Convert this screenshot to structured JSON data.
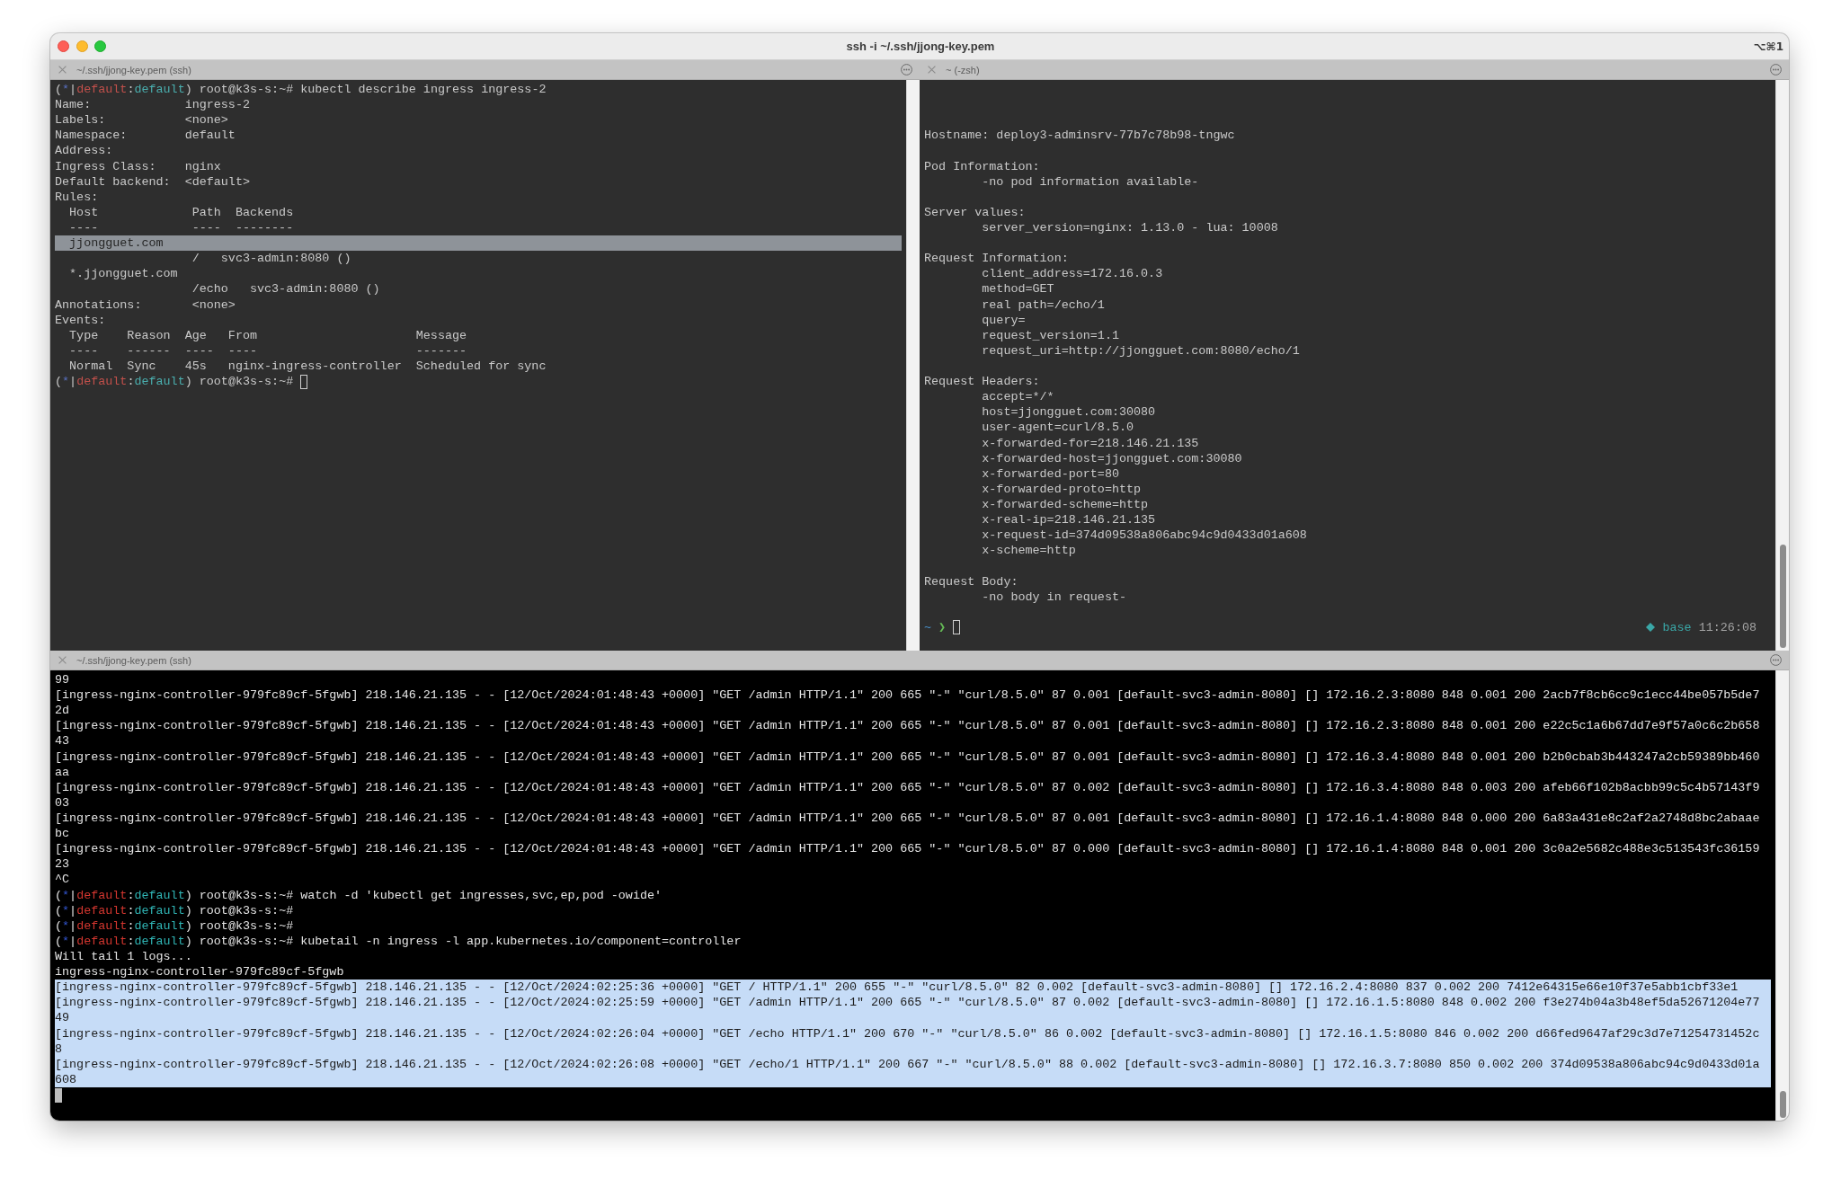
{
  "window": {
    "title": "ssh -i ~/.ssh/jjong-key.pem",
    "shortcut": "⌥⌘1"
  },
  "pane_rows": [
    {
      "panes": [
        {
          "title": "~/.ssh/jjong-key.pem (ssh)",
          "active": false,
          "blocks": [
            {
              "lines": [
                {
                  "kind": "prompt",
                  "segments": [
                    {
                      "kind": "plain",
                      "text": "("
                    },
                    {
                      "kind": "marker",
                      "text": "*"
                    },
                    {
                      "kind": "plain",
                      "text": "|"
                    },
                    {
                      "kind": "context",
                      "text": "default"
                    },
                    {
                      "kind": "plain",
                      "text": ":"
                    },
                    {
                      "kind": "namespace",
                      "text": "default"
                    },
                    {
                      "kind": "plain",
                      "text": ") root@k3s-s:~# kubectl describe ingress ingress-2"
                    }
                  ],
                  "cursor": false,
                  "selected": false
                },
                {
                  "kind": "output",
                  "text": "Name:             ingress-2",
                  "selected": false
                },
                {
                  "kind": "output",
                  "text": "Labels:           <none>",
                  "selected": false
                },
                {
                  "kind": "output",
                  "text": "Namespace:        default",
                  "selected": false
                },
                {
                  "kind": "output",
                  "text": "Address:",
                  "selected": false
                },
                {
                  "kind": "output",
                  "text": "Ingress Class:    nginx",
                  "selected": false
                },
                {
                  "kind": "output",
                  "text": "Default backend:  <default>",
                  "selected": false
                },
                {
                  "kind": "output",
                  "text": "Rules:",
                  "selected": false
                },
                {
                  "kind": "output",
                  "text": "  Host             Path  Backends",
                  "selected": false
                },
                {
                  "kind": "output",
                  "text": "  ----             ----  --------",
                  "selected": false
                },
                {
                  "kind": "output",
                  "text": "  jjongguet.com",
                  "selected": true
                },
                {
                  "kind": "output",
                  "text": "                   /   svc3-admin:8080 ()",
                  "selected": false
                },
                {
                  "kind": "output",
                  "text": "  *.jjongguet.com",
                  "selected": false
                },
                {
                  "kind": "output",
                  "text": "                   /echo   svc3-admin:8080 ()",
                  "selected": false
                },
                {
                  "kind": "output",
                  "text": "Annotations:       <none>",
                  "selected": false
                },
                {
                  "kind": "output",
                  "text": "Events:",
                  "selected": false
                },
                {
                  "kind": "output",
                  "text": "  Type    Reason  Age   From                      Message",
                  "selected": false
                },
                {
                  "kind": "output",
                  "text": "  ----    ------  ----  ----                      -------",
                  "selected": false
                },
                {
                  "kind": "output",
                  "text": "  Normal  Sync    45s   nginx-ingress-controller  Scheduled for sync",
                  "selected": false
                },
                {
                  "kind": "prompt",
                  "segments": [
                    {
                      "kind": "plain",
                      "text": "("
                    },
                    {
                      "kind": "marker",
                      "text": "*"
                    },
                    {
                      "kind": "plain",
                      "text": "|"
                    },
                    {
                      "kind": "context",
                      "text": "default"
                    },
                    {
                      "kind": "plain",
                      "text": ":"
                    },
                    {
                      "kind": "namespace",
                      "text": "default"
                    },
                    {
                      "kind": "plain",
                      "text": ") root@k3s-s:~#"
                    }
                  ],
                  "cursor": true,
                  "selected": false
                }
              ]
            }
          ]
        },
        {
          "title": "~ (-zsh)",
          "active": false,
          "blocks": [
            {
              "lines": [
                {
                  "kind": "output",
                  "text": "Hostname: deploy3-adminsrv-77b7c78b98-tngwc",
                  "selected": false
                }
              ]
            },
            {
              "lines": [
                {
                  "kind": "output",
                  "text": "Pod Information:",
                  "selected": false
                },
                {
                  "kind": "output",
                  "text": "        -no pod information available-",
                  "selected": false
                }
              ]
            },
            {
              "lines": [
                {
                  "kind": "output",
                  "text": "Server values:",
                  "selected": false
                },
                {
                  "kind": "output",
                  "text": "        server_version=nginx: 1.13.0 - lua: 10008",
                  "selected": false
                }
              ]
            },
            {
              "lines": [
                {
                  "kind": "output",
                  "text": "Request Information:",
                  "selected": false
                },
                {
                  "kind": "output",
                  "text": "        client_address=172.16.0.3",
                  "selected": false
                },
                {
                  "kind": "output",
                  "text": "        method=GET",
                  "selected": false
                },
                {
                  "kind": "output",
                  "text": "        real path=/echo/1",
                  "selected": false
                },
                {
                  "kind": "output",
                  "text": "        query=",
                  "selected": false
                },
                {
                  "kind": "output",
                  "text": "        request_version=1.1",
                  "selected": false
                },
                {
                  "kind": "output",
                  "text": "        request_uri=http://jjongguet.com:8080/echo/1",
                  "selected": false
                }
              ]
            },
            {
              "lines": [
                {
                  "kind": "output",
                  "text": "Request Headers:",
                  "selected": false
                },
                {
                  "kind": "output",
                  "text": "        accept=*/*",
                  "selected": false
                },
                {
                  "kind": "output",
                  "text": "        host=jjongguet.com:30080",
                  "selected": false
                },
                {
                  "kind": "output",
                  "text": "        user-agent=curl/8.5.0",
                  "selected": false
                },
                {
                  "kind": "output",
                  "text": "        x-forwarded-for=218.146.21.135",
                  "selected": false
                },
                {
                  "kind": "output",
                  "text": "        x-forwarded-host=jjongguet.com:30080",
                  "selected": false
                },
                {
                  "kind": "output",
                  "text": "        x-forwarded-port=80",
                  "selected": false
                },
                {
                  "kind": "output",
                  "text": "        x-forwarded-proto=http",
                  "selected": false
                },
                {
                  "kind": "output",
                  "text": "        x-forwarded-scheme=http",
                  "selected": false
                },
                {
                  "kind": "output",
                  "text": "        x-real-ip=218.146.21.135",
                  "selected": false
                },
                {
                  "kind": "output",
                  "text": "        x-request-id=374d09538a806abc94c9d0433d01a608",
                  "selected": false
                },
                {
                  "kind": "output",
                  "text": "        x-scheme=http",
                  "selected": false
                }
              ]
            },
            {
              "lines": [
                {
                  "kind": "output",
                  "text": "Request Body:",
                  "selected": false
                },
                {
                  "kind": "output",
                  "text": "        -no body in request-",
                  "selected": false
                }
              ]
            },
            {
              "lines": [
                {
                  "kind": "prompt",
                  "segments": [
                    {
                      "kind": "path",
                      "text": "~"
                    },
                    {
                      "kind": "arrow",
                      "text": " ❯"
                    }
                  ],
                  "cursor": true,
                  "selected": false,
                  "status": [
                    {
                      "kind": "env",
                      "text": "base"
                    },
                    {
                      "kind": "time",
                      "text": "11:26:08"
                    }
                  ]
                }
              ]
            }
          ]
        }
      ]
    },
    {
      "panes": [
        {
          "title": "~/.ssh/jjong-key.pem (ssh)",
          "active": true,
          "blocks": [
            {
              "lines": [
                {
                  "kind": "output",
                  "text": "99",
                  "selected": false
                },
                {
                  "kind": "output",
                  "text": "[ingress-nginx-controller-979fc89cf-5fgwb] 218.146.21.135 - - [12/Oct/2024:01:48:43 +0000] \"GET /admin HTTP/1.1\" 200 665 \"-\" \"curl/8.5.0\" 87 0.001 [default-svc3-admin-8080] [] 172.16.2.3:8080 848 0.001 200 2acb7f8cb6cc9c1ecc44be057b5de7",
                  "selected": false
                },
                {
                  "kind": "output",
                  "text": "2d",
                  "selected": false
                },
                {
                  "kind": "output",
                  "text": "[ingress-nginx-controller-979fc89cf-5fgwb] 218.146.21.135 - - [12/Oct/2024:01:48:43 +0000] \"GET /admin HTTP/1.1\" 200 665 \"-\" \"curl/8.5.0\" 87 0.001 [default-svc3-admin-8080] [] 172.16.2.3:8080 848 0.001 200 e22c5c1a6b67dd7e9f57a0c6c2b658",
                  "selected": false
                },
                {
                  "kind": "output",
                  "text": "43",
                  "selected": false
                },
                {
                  "kind": "output",
                  "text": "[ingress-nginx-controller-979fc89cf-5fgwb] 218.146.21.135 - - [12/Oct/2024:01:48:43 +0000] \"GET /admin HTTP/1.1\" 200 665 \"-\" \"curl/8.5.0\" 87 0.001 [default-svc3-admin-8080] [] 172.16.3.4:8080 848 0.001 200 b2b0cbab3b443247a2cb59389bb460",
                  "selected": false
                },
                {
                  "kind": "output",
                  "text": "aa",
                  "selected": false
                },
                {
                  "kind": "output",
                  "text": "[ingress-nginx-controller-979fc89cf-5fgwb] 218.146.21.135 - - [12/Oct/2024:01:48:43 +0000] \"GET /admin HTTP/1.1\" 200 665 \"-\" \"curl/8.5.0\" 87 0.002 [default-svc3-admin-8080] [] 172.16.3.4:8080 848 0.003 200 afeb66f102b8acbb99c5c4b57143f9",
                  "selected": false
                },
                {
                  "kind": "output",
                  "text": "03",
                  "selected": false
                },
                {
                  "kind": "output",
                  "text": "[ingress-nginx-controller-979fc89cf-5fgwb] 218.146.21.135 - - [12/Oct/2024:01:48:43 +0000] \"GET /admin HTTP/1.1\" 200 665 \"-\" \"curl/8.5.0\" 87 0.001 [default-svc3-admin-8080] [] 172.16.1.4:8080 848 0.000 200 6a83a431e8c2af2a2748d8bc2abaae",
                  "selected": false
                },
                {
                  "kind": "output",
                  "text": "bc",
                  "selected": false
                },
                {
                  "kind": "output",
                  "text": "[ingress-nginx-controller-979fc89cf-5fgwb] 218.146.21.135 - - [12/Oct/2024:01:48:43 +0000] \"GET /admin HTTP/1.1\" 200 665 \"-\" \"curl/8.5.0\" 87 0.000 [default-svc3-admin-8080] [] 172.16.1.4:8080 848 0.001 200 3c0a2e5682c488e3c513543fc36159",
                  "selected": false
                },
                {
                  "kind": "output",
                  "text": "23",
                  "selected": false
                },
                {
                  "kind": "output",
                  "text": "^C",
                  "selected": false
                },
                {
                  "kind": "prompt",
                  "segments": [
                    {
                      "kind": "plain",
                      "text": "("
                    },
                    {
                      "kind": "marker",
                      "text": "*"
                    },
                    {
                      "kind": "plain",
                      "text": "|"
                    },
                    {
                      "kind": "context",
                      "text": "default"
                    },
                    {
                      "kind": "plain",
                      "text": ":"
                    },
                    {
                      "kind": "namespace",
                      "text": "default"
                    },
                    {
                      "kind": "plain",
                      "text": ") root@k3s-s:~# watch -d 'kubectl get ingresses,svc,ep,pod -owide'"
                    }
                  ],
                  "cursor": false,
                  "selected": false
                },
                {
                  "kind": "prompt",
                  "segments": [
                    {
                      "kind": "plain",
                      "text": "("
                    },
                    {
                      "kind": "marker",
                      "text": "*"
                    },
                    {
                      "kind": "plain",
                      "text": "|"
                    },
                    {
                      "kind": "context",
                      "text": "default"
                    },
                    {
                      "kind": "plain",
                      "text": ":"
                    },
                    {
                      "kind": "namespace",
                      "text": "default"
                    },
                    {
                      "kind": "plain",
                      "text": ") root@k3s-s:~#"
                    }
                  ],
                  "cursor": false,
                  "selected": false
                },
                {
                  "kind": "prompt",
                  "segments": [
                    {
                      "kind": "plain",
                      "text": "("
                    },
                    {
                      "kind": "marker",
                      "text": "*"
                    },
                    {
                      "kind": "plain",
                      "text": "|"
                    },
                    {
                      "kind": "context",
                      "text": "default"
                    },
                    {
                      "kind": "plain",
                      "text": ":"
                    },
                    {
                      "kind": "namespace",
                      "text": "default"
                    },
                    {
                      "kind": "plain",
                      "text": ") root@k3s-s:~#"
                    }
                  ],
                  "cursor": false,
                  "selected": false
                },
                {
                  "kind": "prompt",
                  "segments": [
                    {
                      "kind": "plain",
                      "text": "("
                    },
                    {
                      "kind": "marker",
                      "text": "*"
                    },
                    {
                      "kind": "plain",
                      "text": "|"
                    },
                    {
                      "kind": "context",
                      "text": "default"
                    },
                    {
                      "kind": "plain",
                      "text": ":"
                    },
                    {
                      "kind": "namespace",
                      "text": "default"
                    },
                    {
                      "kind": "plain",
                      "text": ") root@k3s-s:~# kubetail -n ingress -l app.kubernetes.io/component=controller"
                    }
                  ],
                  "cursor": false,
                  "selected": false
                },
                {
                  "kind": "output",
                  "text": "Will tail 1 logs...",
                  "selected": false
                },
                {
                  "kind": "output",
                  "text": "ingress-nginx-controller-979fc89cf-5fgwb",
                  "selected": false
                },
                {
                  "kind": "output",
                  "text": "[ingress-nginx-controller-979fc89cf-5fgwb] 218.146.21.135 - - [12/Oct/2024:02:25:36 +0000] \"GET / HTTP/1.1\" 200 655 \"-\" \"curl/8.5.0\" 82 0.002 [default-svc3-admin-8080] [] 172.16.2.4:8080 837 0.002 200 7412e64315e66e10f37e5abb1cbf33e1",
                  "selected": true
                },
                {
                  "kind": "output",
                  "text": "[ingress-nginx-controller-979fc89cf-5fgwb] 218.146.21.135 - - [12/Oct/2024:02:25:59 +0000] \"GET /admin HTTP/1.1\" 200 665 \"-\" \"curl/8.5.0\" 87 0.002 [default-svc3-admin-8080] [] 172.16.1.5:8080 848 0.002 200 f3e274b04a3b48ef5da52671204e77",
                  "selected": true
                },
                {
                  "kind": "output",
                  "text": "49",
                  "selected": true
                },
                {
                  "kind": "output",
                  "text": "[ingress-nginx-controller-979fc89cf-5fgwb] 218.146.21.135 - - [12/Oct/2024:02:26:04 +0000] \"GET /echo HTTP/1.1\" 200 670 \"-\" \"curl/8.5.0\" 86 0.002 [default-svc3-admin-8080] [] 172.16.1.5:8080 846 0.002 200 d66fed9647af29c3d7e71254731452c",
                  "selected": true
                },
                {
                  "kind": "output",
                  "text": "8",
                  "selected": true
                },
                {
                  "kind": "output",
                  "text": "[ingress-nginx-controller-979fc89cf-5fgwb] 218.146.21.135 - - [12/Oct/2024:02:26:08 +0000] \"GET /echo/1 HTTP/1.1\" 200 667 \"-\" \"curl/8.5.0\" 88 0.002 [default-svc3-admin-8080] [] 172.16.3.7:8080 850 0.002 200 374d09538a806abc94c9d0433d01a",
                  "selected": true
                },
                {
                  "kind": "output",
                  "text": "608",
                  "selected": true
                },
                {
                  "kind": "cursor"
                }
              ]
            }
          ]
        }
      ]
    }
  ]
}
